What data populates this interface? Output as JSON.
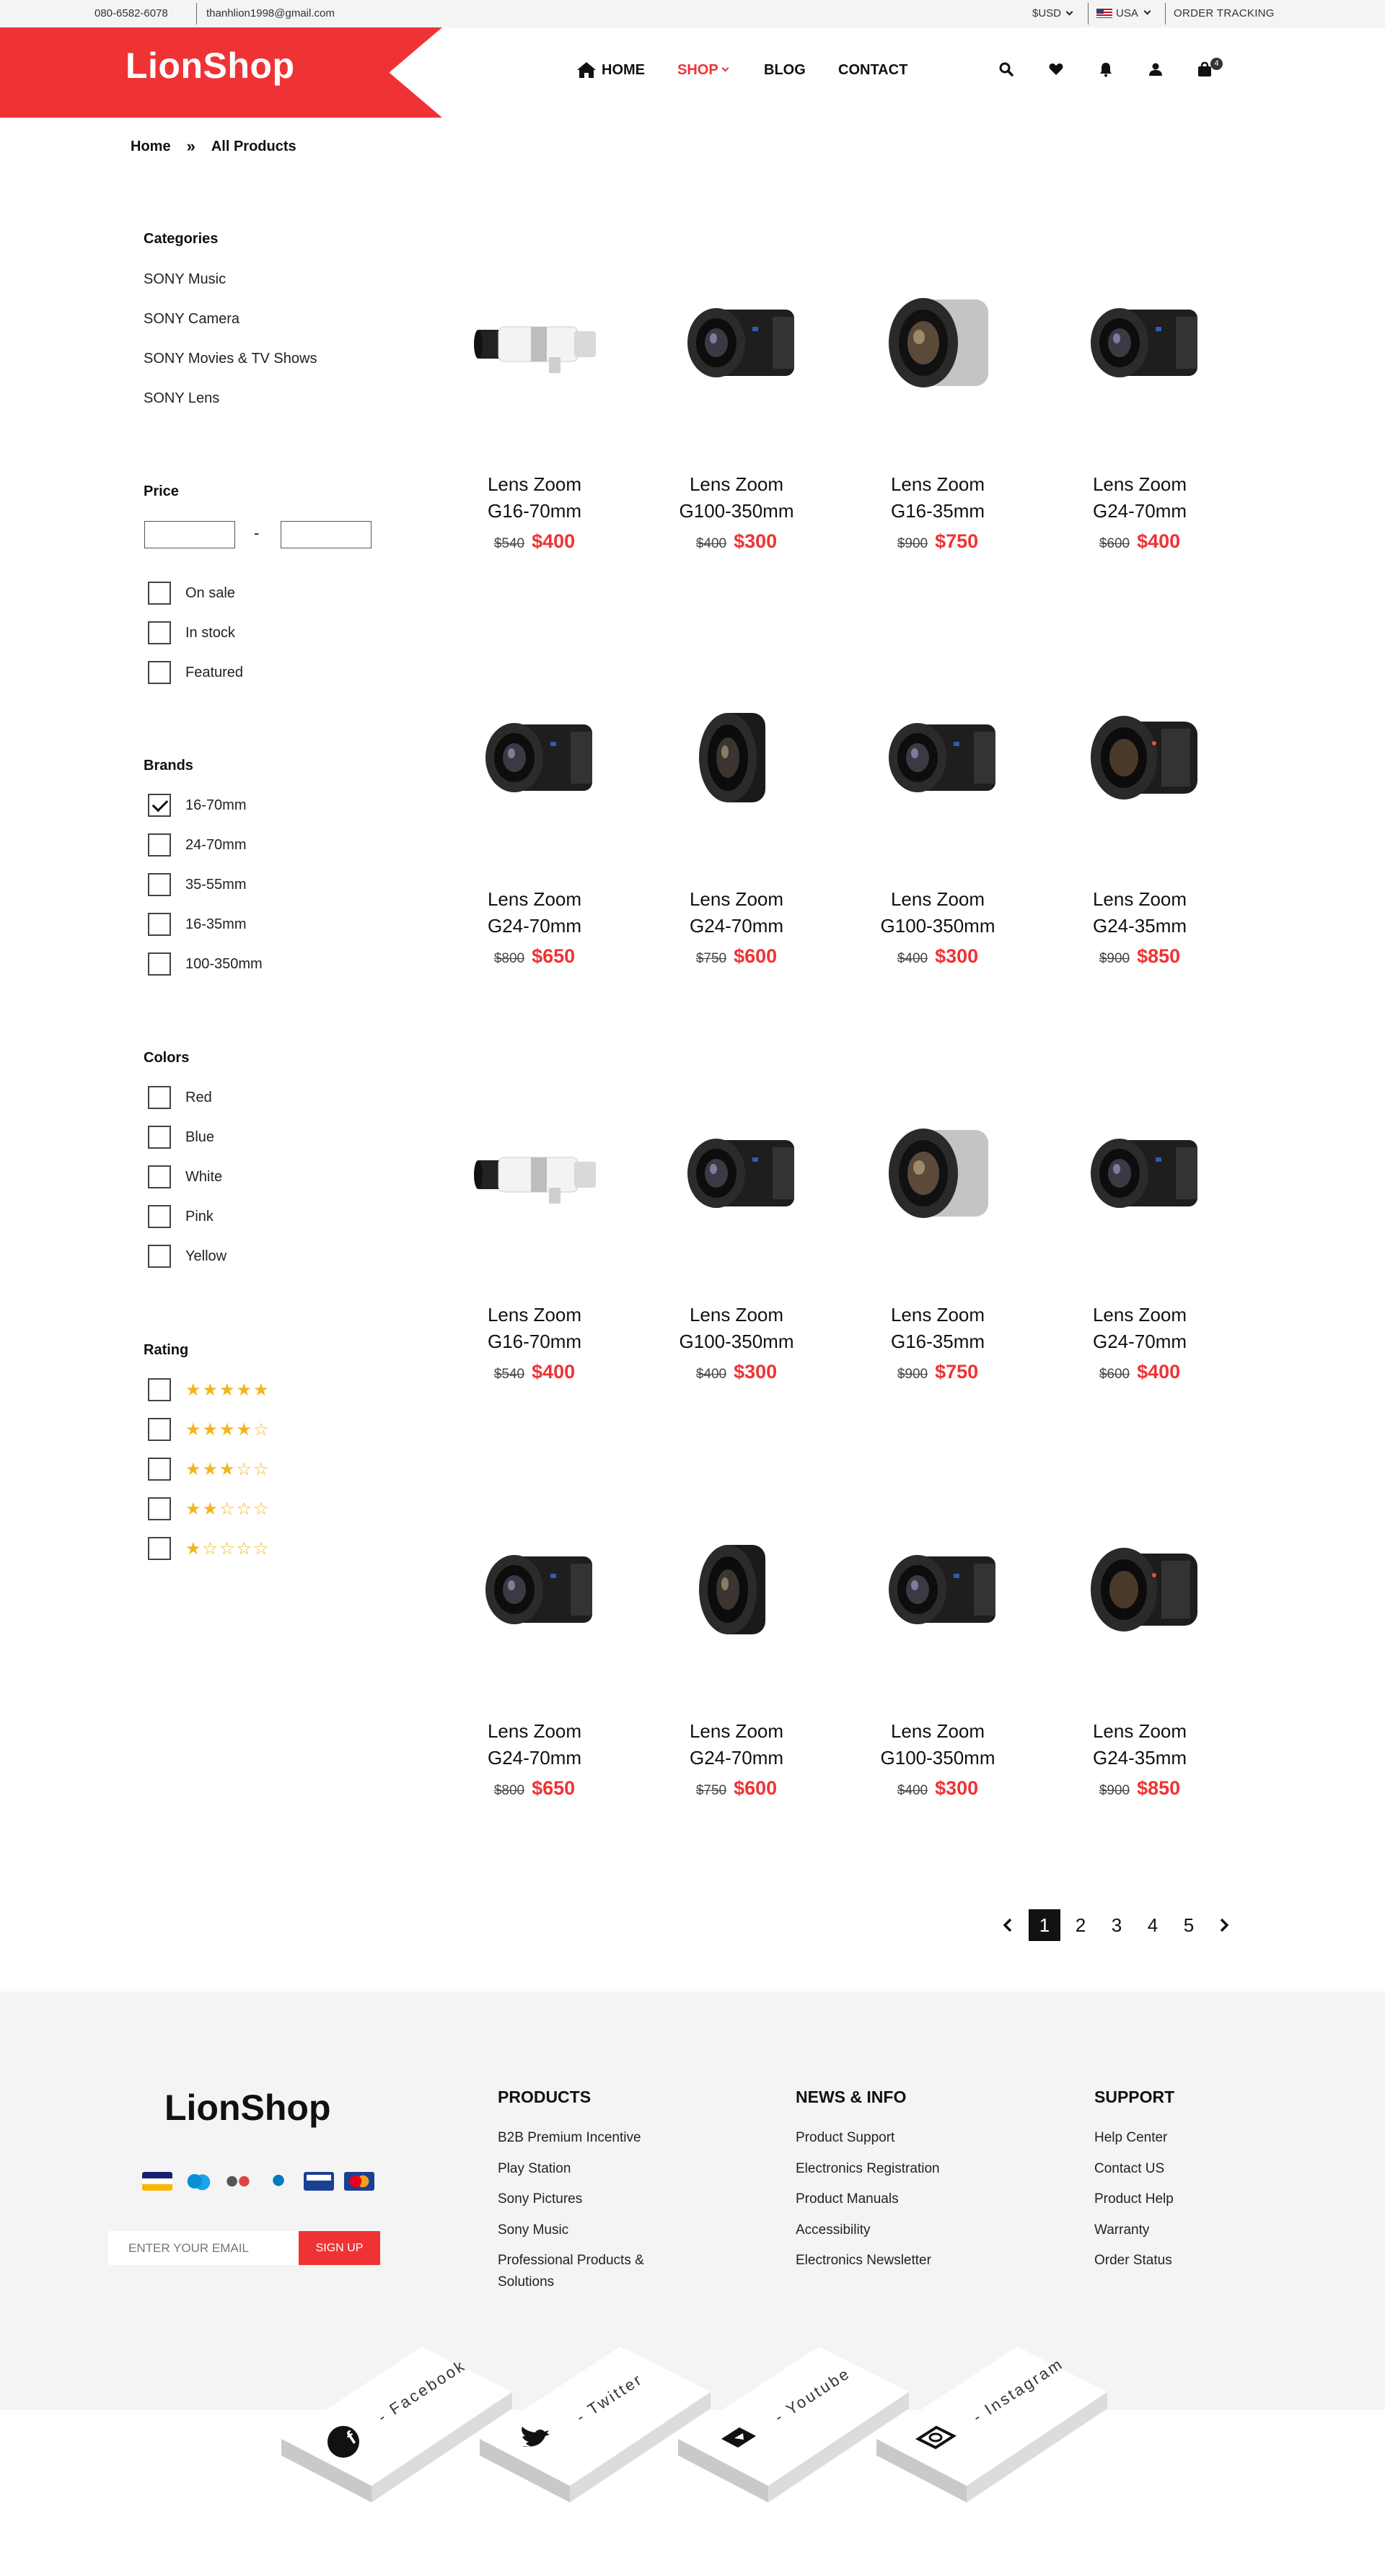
{
  "topbar": {
    "phone": "080-6582-6078",
    "email": "thanhlion1998@gmail.com",
    "currency": "$USD",
    "country": "USA",
    "tracking": "ORDER TRACKING"
  },
  "header": {
    "logo": "LionShop",
    "nav": {
      "home": "HOME",
      "shop": "SHOP",
      "blog": "BLOG",
      "contact": "CONTACT"
    },
    "cart_count": "4",
    "icons": [
      "search-icon",
      "heart-icon",
      "bell-icon",
      "user-icon",
      "shopping-bag-icon"
    ],
    "accent_color": "#ef3334"
  },
  "breadcrumb": {
    "home": "Home",
    "current": "All Products"
  },
  "sidebar": {
    "categories_title": "Categories",
    "categories": [
      "SONY Music",
      "SONY Camera",
      "SONY Movies & TV Shows",
      "SONY Lens"
    ],
    "price_title": "Price",
    "price_separator": "-",
    "price_filters": [
      "On sale",
      "In stock",
      "Featured"
    ],
    "brands_title": "Brands",
    "brands": [
      "16-70mm",
      "24-70mm",
      "35-55mm",
      "16-35mm",
      "100-350mm"
    ],
    "brands_checked": [
      true,
      false,
      false,
      false,
      false
    ],
    "colors_title": "Colors",
    "colors": [
      "Red",
      "Blue",
      "White",
      "Pink",
      "Yellow"
    ],
    "rating_title": "Rating",
    "ratings": [
      "★★★★★",
      "★★★★☆",
      "★★★☆☆",
      "★★☆☆☆",
      "★☆☆☆☆"
    ]
  },
  "products": [
    {
      "line1": "Lens Zoom",
      "line2": "G16-70mm",
      "old": "$540",
      "price": "$400",
      "type": "white"
    },
    {
      "line1": "Lens Zoom",
      "line2": "G100-350mm",
      "old": "$400",
      "price": "$300",
      "type": "black"
    },
    {
      "line1": "Lens Zoom",
      "line2": "G16-35mm",
      "old": "$900",
      "price": "$750",
      "type": "silver"
    },
    {
      "line1": "Lens Zoom",
      "line2": "G24-70mm",
      "old": "$600",
      "price": "$400",
      "type": "black"
    },
    {
      "line1": "Lens Zoom",
      "line2": "G24-70mm",
      "old": "$800",
      "price": "$650",
      "type": "black"
    },
    {
      "line1": "Lens Zoom",
      "line2": "G24-70mm",
      "old": "$750",
      "price": "$600",
      "type": "pancake"
    },
    {
      "line1": "Lens Zoom",
      "line2": "G100-350mm",
      "old": "$400",
      "price": "$300",
      "type": "black"
    },
    {
      "line1": "Lens Zoom",
      "line2": "G24-35mm",
      "old": "$900",
      "price": "$850",
      "type": "wide"
    },
    {
      "line1": "Lens Zoom",
      "line2": "G16-70mm",
      "old": "$540",
      "price": "$400",
      "type": "white"
    },
    {
      "line1": "Lens Zoom",
      "line2": "G100-350mm",
      "old": "$400",
      "price": "$300",
      "type": "black"
    },
    {
      "line1": "Lens Zoom",
      "line2": "G16-35mm",
      "old": "$900",
      "price": "$750",
      "type": "silver"
    },
    {
      "line1": "Lens Zoom",
      "line2": "G24-70mm",
      "old": "$600",
      "price": "$400",
      "type": "black"
    },
    {
      "line1": "Lens Zoom",
      "line2": "G24-70mm",
      "old": "$800",
      "price": "$650",
      "type": "black"
    },
    {
      "line1": "Lens Zoom",
      "line2": "G24-70mm",
      "old": "$750",
      "price": "$600",
      "type": "pancake"
    },
    {
      "line1": "Lens Zoom",
      "line2": "G100-350mm",
      "old": "$400",
      "price": "$300",
      "type": "black"
    },
    {
      "line1": "Lens Zoom",
      "line2": "G24-35mm",
      "old": "$900",
      "price": "$850",
      "type": "wide"
    }
  ],
  "pagination": {
    "pages": [
      "1",
      "2",
      "3",
      "4",
      "5"
    ],
    "active": "1"
  },
  "footer": {
    "logo": "LionShop",
    "newsletter_placeholder": "ENTER YOUR EMAIL",
    "signup": "SIGN UP",
    "columns": [
      {
        "title": "PRODUCTS",
        "links": [
          "B2B Premium Incentive",
          "Play Station",
          "Sony Pictures",
          "Sony Music",
          "Professional Products & Solutions"
        ]
      },
      {
        "title": "NEWS & INFO",
        "links": [
          "Product Support",
          "Electronics Registration",
          "Product Manuals",
          "Accessibility",
          "Electronics Newsletter"
        ]
      },
      {
        "title": "SUPPORT",
        "links": [
          "Help Center",
          "Contact US",
          "Product Help",
          "Warranty",
          "Order Status"
        ]
      }
    ],
    "social": [
      "- Facebook",
      "- Twitter",
      "- Youtube",
      "- Instagram"
    ]
  }
}
